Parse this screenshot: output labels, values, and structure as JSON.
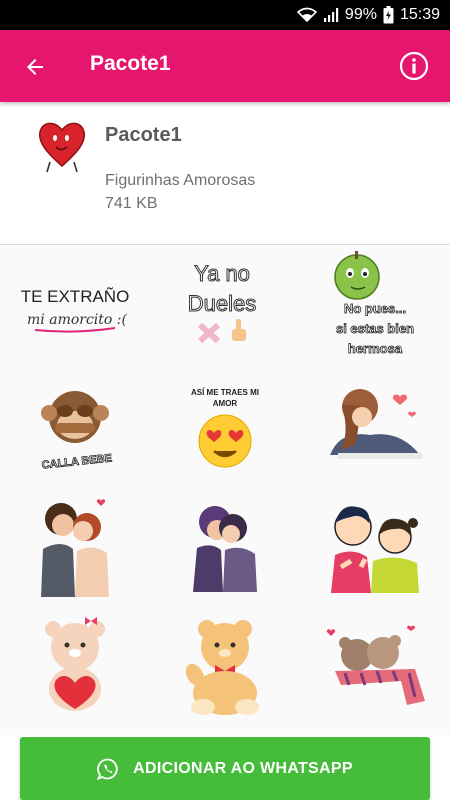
{
  "status_bar": {
    "battery": "99%",
    "time": "15:39"
  },
  "app_bar": {
    "title": "Pacote1",
    "back_icon": "arrow-left-icon",
    "info_icon": "info-icon"
  },
  "pack": {
    "name": "Pacote1",
    "description": "Figurinhas Amorosas",
    "size": "741 KB",
    "icon": "heart-icon"
  },
  "stickers": [
    {
      "name": "te-extrano-sticker",
      "line1": "TE EXTRAÑO",
      "line2": "mi amorcito :("
    },
    {
      "name": "ya-no-dueles-sticker",
      "line1": "Ya no",
      "line2": "Dueles"
    },
    {
      "name": "apple-sticker",
      "line1": "No pues...",
      "line2": "si estas bien",
      "line3": "hermosa"
    },
    {
      "name": "monkey-sticker",
      "line1": "CALLA BEBE"
    },
    {
      "name": "heart-eyes-emoji-sticker",
      "line1": "ASÍ ME TRAES MI",
      "line2": "AMOR"
    },
    {
      "name": "hugging-couple-sticker"
    },
    {
      "name": "kissing-couple-sticker"
    },
    {
      "name": "kissing-couple-2-sticker"
    },
    {
      "name": "cartoon-couple-sticker"
    },
    {
      "name": "teddy-bear-heart-sticker"
    },
    {
      "name": "teddy-bear-bowtie-sticker"
    },
    {
      "name": "teddy-bears-scarf-sticker"
    }
  ],
  "action": {
    "label": "ADICIONAR AO WHATSAPP",
    "icon": "whatsapp-icon"
  },
  "colors": {
    "app_bar": "#e6166e",
    "button": "#45bc3a"
  }
}
